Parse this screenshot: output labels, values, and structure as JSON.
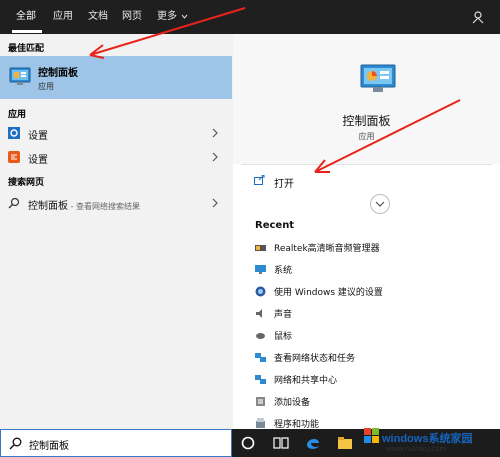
{
  "tabs": [
    {
      "label": "全部"
    },
    {
      "label": "应用"
    },
    {
      "label": "文档"
    },
    {
      "label": "网页"
    },
    {
      "label": "更多"
    }
  ],
  "left": {
    "best_match_heading": "最佳匹配",
    "best_match": {
      "title": "控制面板",
      "subtitle": "应用"
    },
    "apps_heading": "应用",
    "apps": [
      {
        "label": "设置",
        "icon": "gear-icon"
      },
      {
        "label": "设置",
        "icon": "settings-colored-icon"
      }
    ],
    "web_heading": "搜索网页",
    "web_item": {
      "label": "控制面板",
      "suffix": " - 查看网络搜索结果"
    }
  },
  "right": {
    "title": "控制面板",
    "subtitle": "应用",
    "open_label": "打开",
    "recent_heading": "Recent",
    "recent_items": [
      {
        "label": "Realtek高清晰音频管理器",
        "icon": "speaker-icon"
      },
      {
        "label": "系统",
        "icon": "monitor-icon"
      },
      {
        "label": "使用 Windows 建议的设置",
        "icon": "shield-icon"
      },
      {
        "label": "声音",
        "icon": "sound-icon"
      },
      {
        "label": "鼠标",
        "icon": "mouse-icon"
      },
      {
        "label": "查看网络状态和任务",
        "icon": "network-icon"
      },
      {
        "label": "网络和共享中心",
        "icon": "network-icon"
      },
      {
        "label": "添加设备",
        "icon": "device-icon"
      },
      {
        "label": "程序和功能",
        "icon": "programs-icon"
      }
    ]
  },
  "taskbar": {
    "search_value": "控制面板"
  },
  "watermark": {
    "main": "windows系统家园",
    "url": "www.ruinaiu.com"
  },
  "colors": {
    "selected": "#9ec5e8",
    "topbar": "#1f1f1f",
    "annotation": "#e8231c"
  }
}
